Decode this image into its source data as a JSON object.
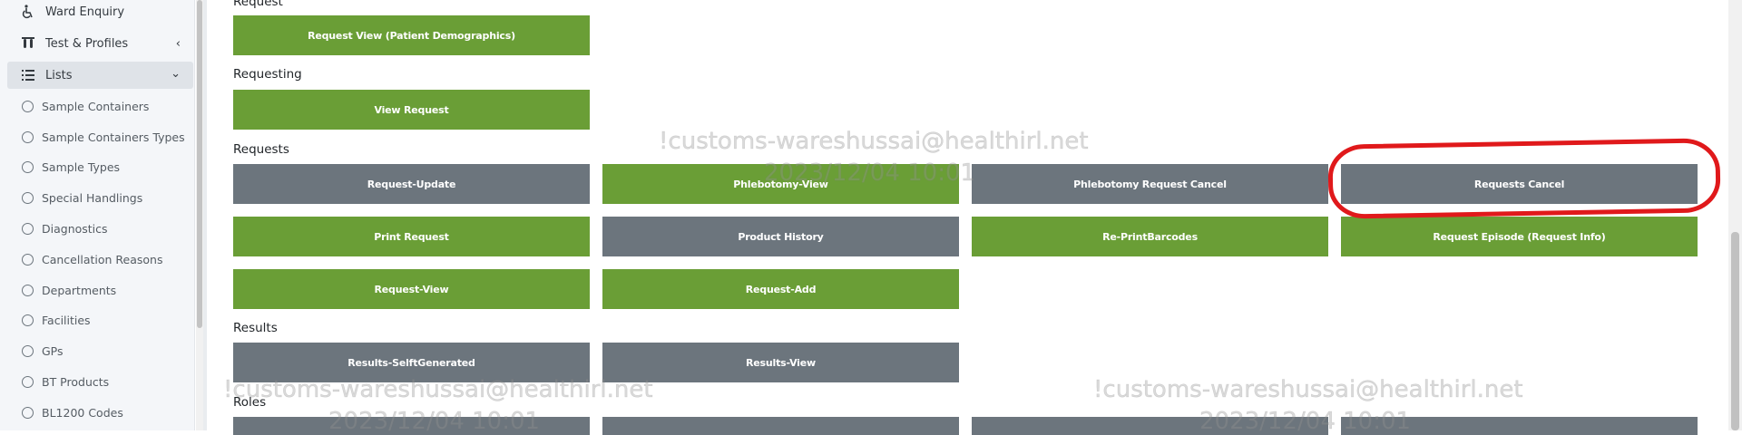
{
  "sidebar": {
    "items": [
      {
        "label": "Ward Enquiry",
        "icon": "wheelchair-icon"
      },
      {
        "label": "Test & Profiles",
        "icon": "test-tubes-icon",
        "chevron": "‹"
      },
      {
        "label": "Lists",
        "icon": "list-icon",
        "chevron": "⌄"
      }
    ],
    "sub_items": [
      "Sample Containers",
      "Sample Containers Types",
      "Sample Types",
      "Special Handlings",
      "Diagnostics",
      "Cancellation Reasons",
      "Departments",
      "Facilities",
      "GPs",
      "BT Products",
      "BL1200 Codes"
    ]
  },
  "sections": {
    "request": {
      "label": "Request",
      "buttons": [
        {
          "label": "Request View (Patient Demographics)",
          "color": "green"
        }
      ]
    },
    "requesting": {
      "label": "Requesting",
      "buttons": [
        {
          "label": "View Request",
          "color": "green"
        }
      ]
    },
    "requests": {
      "label": "Requests",
      "buttons": [
        {
          "label": "Request-Update",
          "color": "gray"
        },
        {
          "label": "Phlebotomy-View",
          "color": "green"
        },
        {
          "label": "Phlebotomy Request Cancel",
          "color": "gray"
        },
        {
          "label": "Requests Cancel",
          "color": "gray"
        },
        {
          "label": "Print Request",
          "color": "green"
        },
        {
          "label": "Product History",
          "color": "gray"
        },
        {
          "label": "Re-PrintBarcodes",
          "color": "green"
        },
        {
          "label": "Request Episode (Request Info)",
          "color": "green"
        },
        {
          "label": "Request-View",
          "color": "green"
        },
        {
          "label": "Request-Add",
          "color": "green"
        }
      ]
    },
    "results": {
      "label": "Results",
      "buttons": [
        {
          "label": "Results-SelftGenerated",
          "color": "gray"
        },
        {
          "label": "Results-View",
          "color": "gray"
        }
      ]
    },
    "roles": {
      "label": "Roles"
    }
  },
  "watermark": {
    "user": "!customs-wareshussai@healthirl.net",
    "timestamp": "2023/12/04 10:01"
  },
  "colors": {
    "green": "#6a9e36",
    "gray": "#6c757d",
    "annotation": "#e0191b"
  }
}
